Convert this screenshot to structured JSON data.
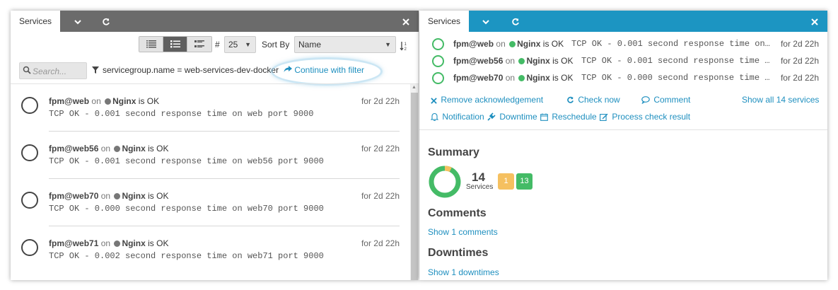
{
  "colors": {
    "ok": "#44bb66",
    "warning": "#f5c060",
    "link": "#1e8fbf",
    "left_tabbar": "#6b6b6b",
    "right_tabbar": "#1c95c2"
  },
  "left": {
    "tab_label": "Services",
    "tab_icons": [
      "chevron-down-icon",
      "refresh-icon",
      "close-icon"
    ],
    "view_modes": [
      "minimal-list-icon",
      "default-list-icon",
      "detailed-list-icon"
    ],
    "active_view": 1,
    "limit_label": "#",
    "limit_value": "25",
    "sort_label": "Sort By",
    "sort_value": "Name",
    "search_placeholder": "Search...",
    "filter_text": "servicegroup.name = web-services-dev-docker",
    "continue_label": "Continue with filter",
    "services": [
      {
        "service": "fpm@web",
        "on": "on",
        "host": "Nginx",
        "state_text": "is OK",
        "time": "for 2d 22h",
        "output": "TCP OK - 0.001 second response time on web port 9000"
      },
      {
        "service": "fpm@web56",
        "on": "on",
        "host": "Nginx",
        "state_text": "is OK",
        "time": "for 2d 22h",
        "output": "TCP OK - 0.001 second response time on web56 port 9000"
      },
      {
        "service": "fpm@web70",
        "on": "on",
        "host": "Nginx",
        "state_text": "is OK",
        "time": "for 2d 22h",
        "output": "TCP OK - 0.000 second response time on web70 port 9000"
      },
      {
        "service": "fpm@web71",
        "on": "on",
        "host": "Nginx",
        "state_text": "is OK",
        "time": "for 2d 22h",
        "output": "TCP OK - 0.002 second response time on web71 port 9000"
      }
    ]
  },
  "right": {
    "tab_label": "Services",
    "tab_icons": [
      "chevron-down-icon",
      "refresh-icon",
      "close-icon"
    ],
    "services": [
      {
        "service": "fpm@web",
        "on": "on",
        "host": "Nginx",
        "state_text": "is OK",
        "time": "for 2d 22h",
        "output": "TCP OK - 0.001 second response time on..."
      },
      {
        "service": "fpm@web56",
        "on": "on",
        "host": "Nginx",
        "state_text": "is OK",
        "time": "for 2d 22h",
        "output": "TCP OK - 0.001 second response time ..."
      },
      {
        "service": "fpm@web70",
        "on": "on",
        "host": "Nginx",
        "state_text": "is OK",
        "time": "for 2d 22h",
        "output": "TCP OK - 0.000 second response time ..."
      }
    ],
    "actions": {
      "remove_ack": "Remove acknowledgement",
      "check_now": "Check now",
      "comment": "Comment",
      "show_all": "Show all 14 services",
      "notification": "Notification",
      "downtime": "Downtime",
      "reschedule": "Reschedule",
      "process_check": "Process check result"
    },
    "summary": {
      "title": "Summary",
      "total": "14",
      "label": "Services",
      "warning_count": "1",
      "ok_count": "13",
      "warning_fraction": 0.0714
    },
    "comments": {
      "title": "Comments",
      "link": "Show 1 comments"
    },
    "downtimes": {
      "title": "Downtimes",
      "link": "Show 1 downtimes"
    }
  }
}
